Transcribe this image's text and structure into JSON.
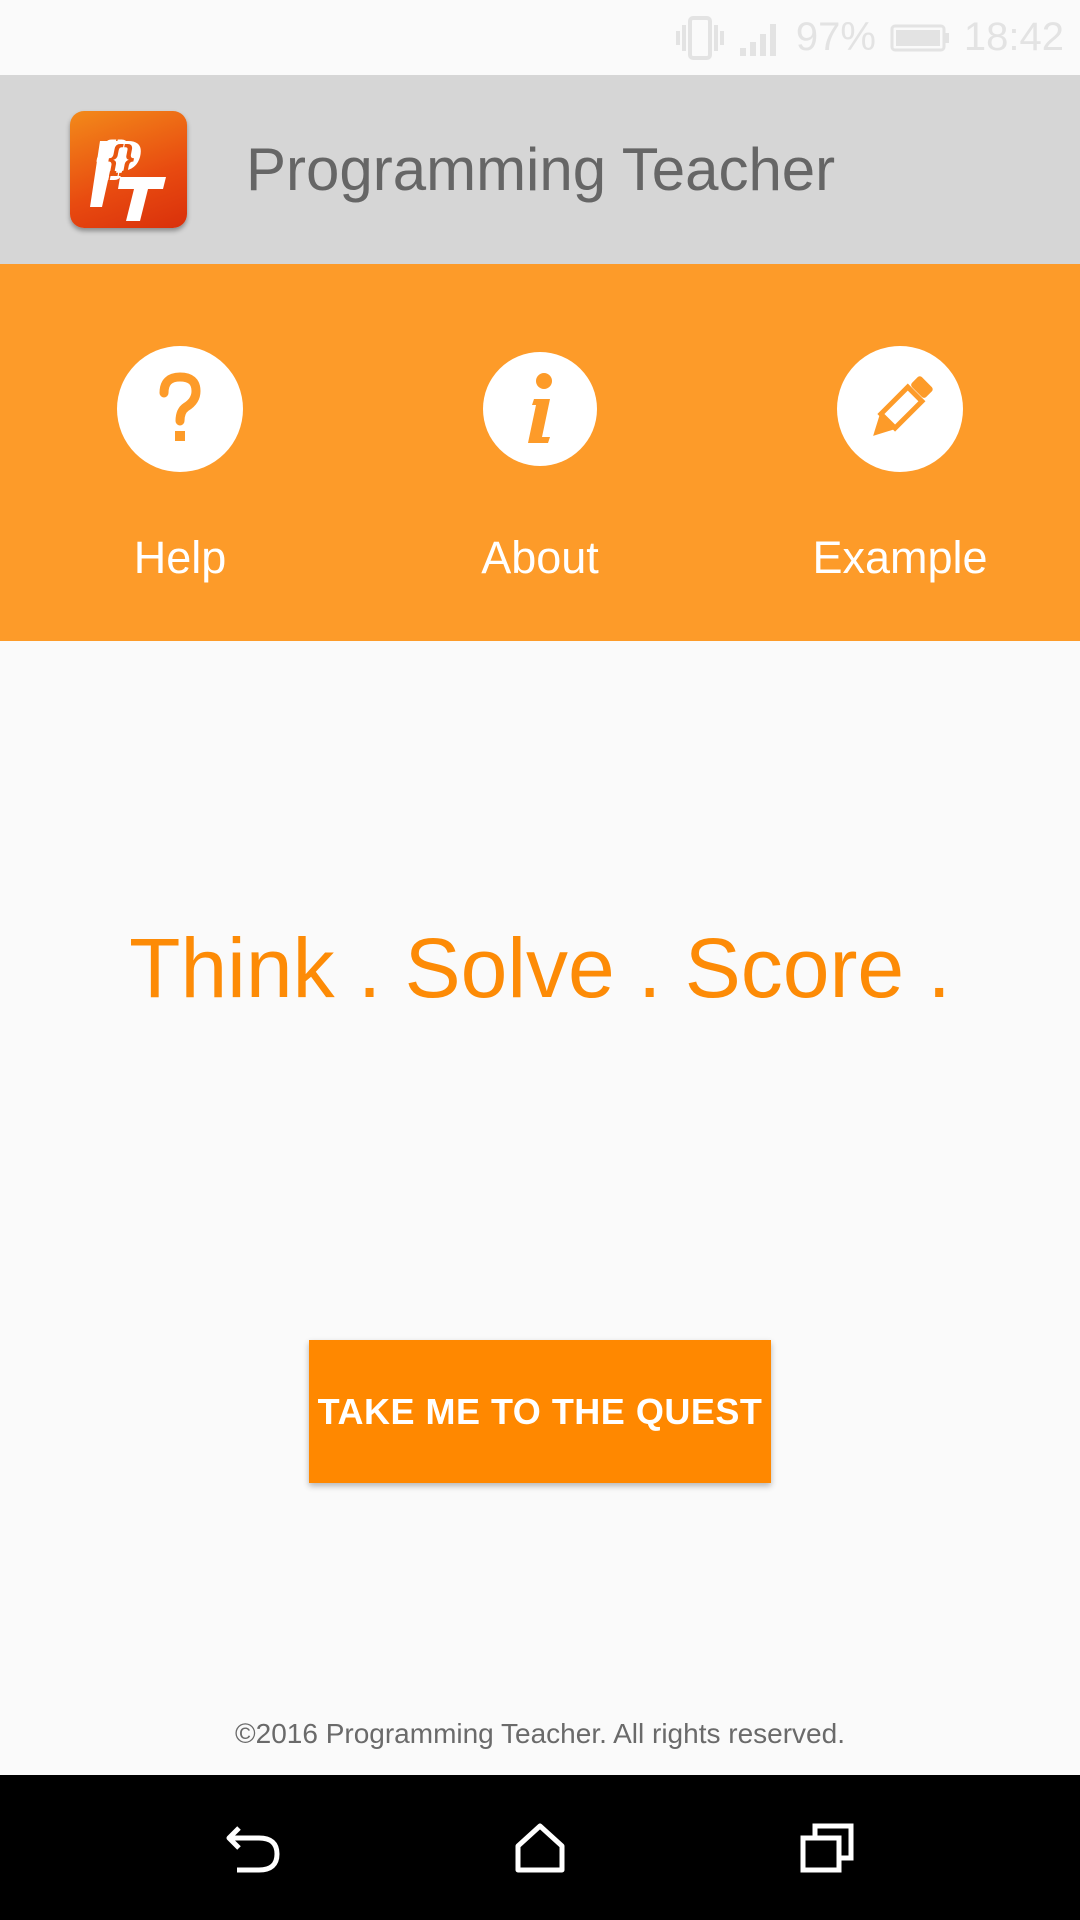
{
  "status_bar": {
    "battery": "97%",
    "time": "18:42",
    "icons": [
      "vibrate-icon",
      "signal-icon",
      "battery-icon"
    ]
  },
  "app_bar": {
    "title": "Programming Teacher",
    "logo_text": "PT"
  },
  "menu": {
    "items": [
      {
        "label": "Help",
        "icon": "help-icon"
      },
      {
        "label": "About",
        "icon": "info-icon"
      },
      {
        "label": "Example",
        "icon": "pencil-icon"
      }
    ]
  },
  "main": {
    "tagline": "Think . Solve . Score .",
    "cta_label": "TAKE ME TO THE QUEST"
  },
  "footer": {
    "copyright": "©2016 Programming Teacher. All rights reserved."
  },
  "nav_bar": {
    "buttons": [
      "back-icon",
      "home-icon",
      "recents-icon"
    ]
  },
  "colors": {
    "accent_orange": "#fd9b29",
    "button_orange": "#ff8800",
    "tagline_orange": "#fd8b06",
    "app_bar_gray": "#d6d6d6",
    "background": "#fafafa"
  }
}
